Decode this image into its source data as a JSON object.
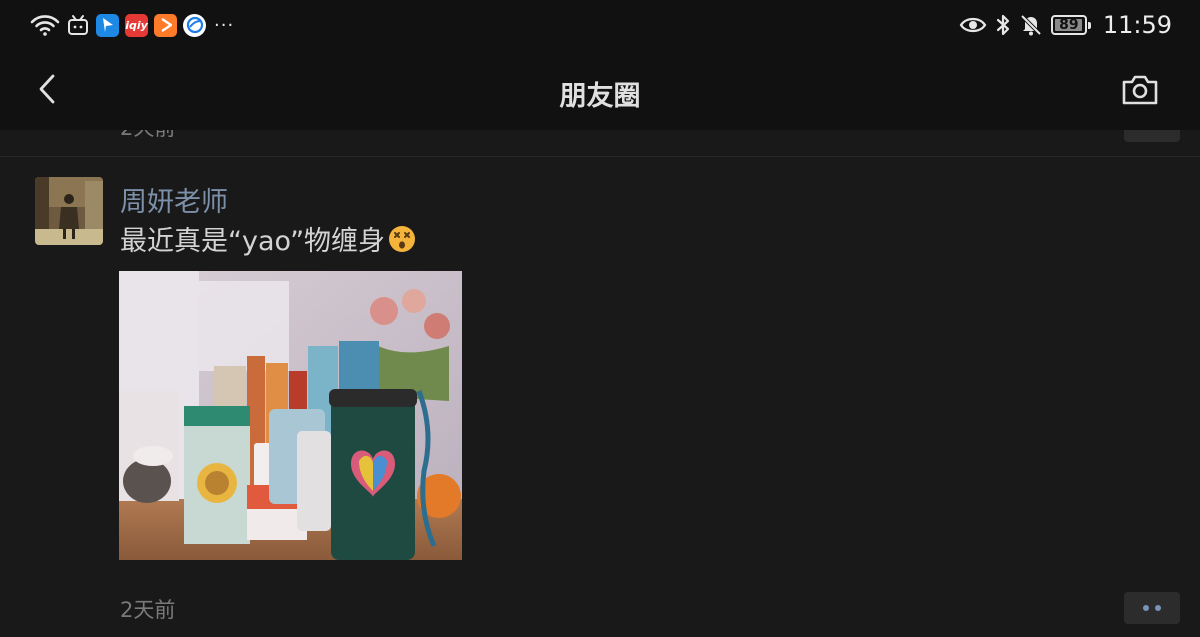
{
  "status_bar": {
    "left_icons": [
      "wifi-icon",
      "bilibili-app-icon",
      "bookmark-app-icon",
      "iqiyi-app-icon",
      "video-app-icon",
      "browser-app-icon"
    ],
    "iqiyi_label": "iqiy",
    "more_dots": "···",
    "right_icons": [
      "eye-icon",
      "bluetooth-icon",
      "bell-mute-icon",
      "battery-icon"
    ],
    "battery_level": "89",
    "time": "11:59"
  },
  "nav": {
    "title": "朋友圈",
    "back_icon": "chevron-left-icon",
    "camera_icon": "camera-icon"
  },
  "previous_post": {
    "time": "2天前"
  },
  "post": {
    "author": "周妍老师",
    "text": "最近真是“yao”物缠身",
    "emoji": "dizzy-face-emoji",
    "photo_icon": "photo-thumbnail",
    "time": "2天前",
    "more_icon": "more-dots-icon"
  },
  "colors": {
    "background": "#191919",
    "bar": "#111111",
    "author_link": "#7d90a9",
    "more_dot": "#7a94b5"
  }
}
